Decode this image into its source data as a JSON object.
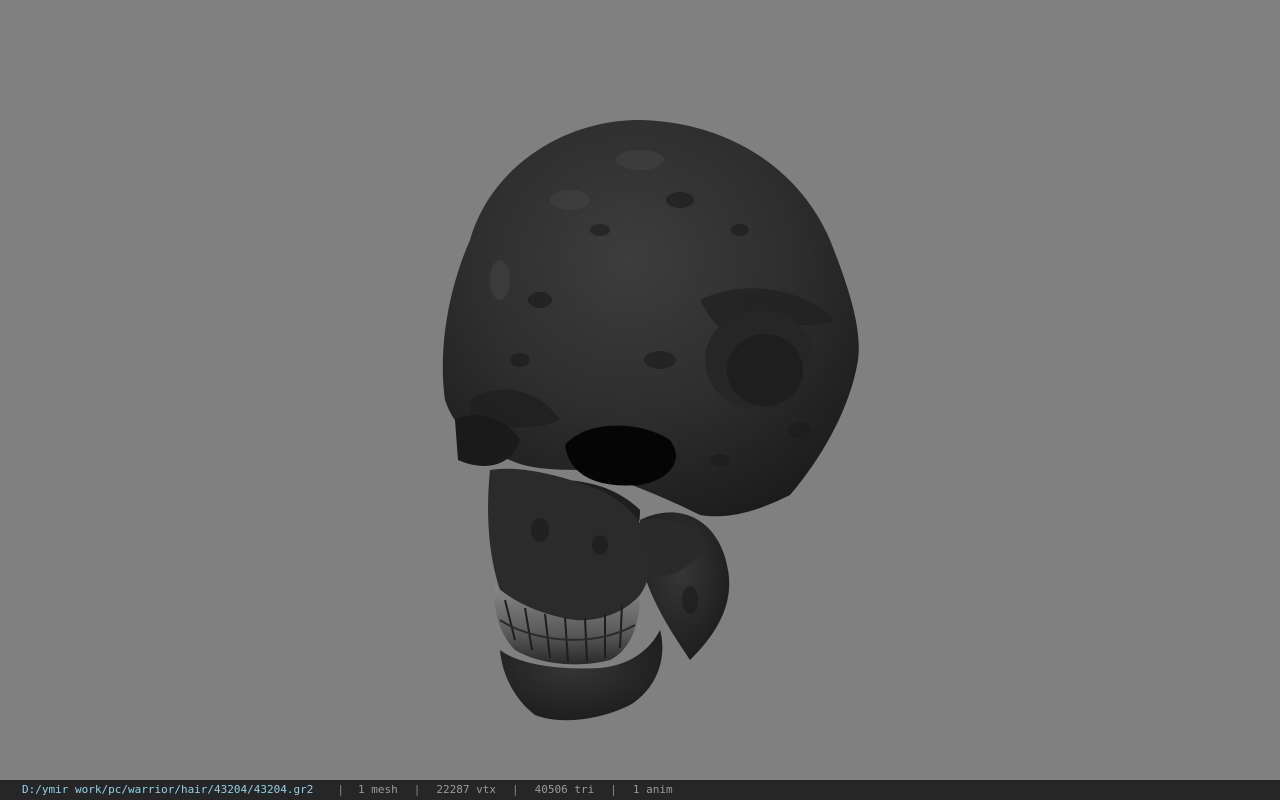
{
  "viewer": {
    "background_color": "#808080",
    "model_name": "skull-model"
  },
  "status_bar": {
    "path": "D:/ymir work/pc/warrior/hair/43204/43204.gr2",
    "separator": "|",
    "mesh": "1 mesh",
    "vtx": "22287 vtx",
    "tri": "40506 tri",
    "anim": "1 anim",
    "path_color": "#8fd0e8",
    "bar_color": "#262626"
  }
}
